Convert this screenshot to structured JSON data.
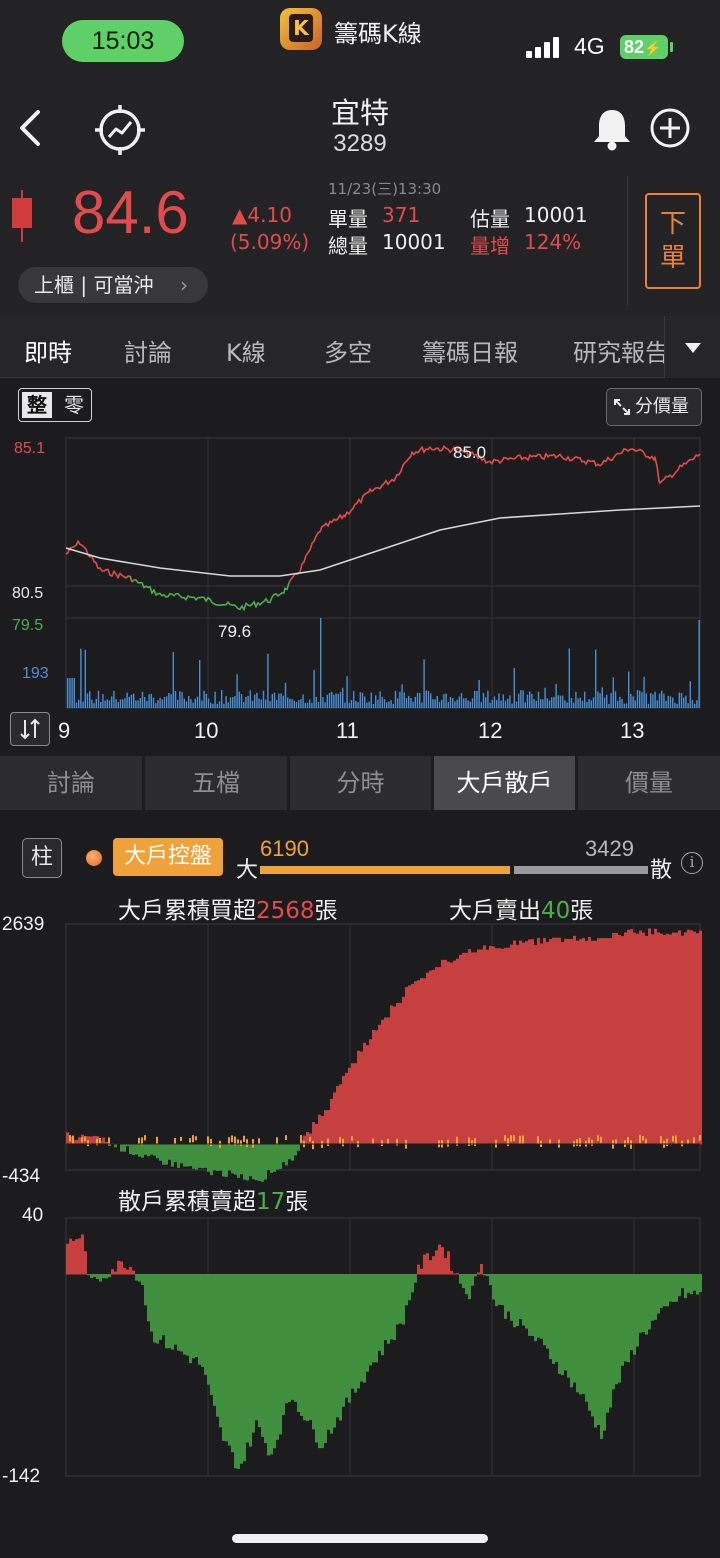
{
  "status_bar": {
    "time": "15:03",
    "app_name": "籌碼K線",
    "network": "4G",
    "battery": "82"
  },
  "header": {
    "stock_name": "宜特",
    "stock_code": "3289",
    "price": "84.6",
    "change": "▲4.10",
    "change_pct": "(5.09%)",
    "datetime": "11/23(三)13:30",
    "unit_volume_label": "單量",
    "unit_volume": "371",
    "total_volume_label": "總量",
    "total_volume": "10001",
    "est_volume_label": "估量",
    "est_volume": "10001",
    "volume_increase_label": "量增",
    "volume_increase": "124%",
    "market_tag": "上櫃 | 可當沖",
    "order_button": "下單",
    "colors": {
      "up": "#e24b4b",
      "accent": "#e8823a"
    }
  },
  "tabs": [
    "即時",
    "討論",
    "K線",
    "多空",
    "籌碼日報",
    "研究報告"
  ],
  "intraday": {
    "toggle_on": "整",
    "toggle_off": "零",
    "price_volume_button": "分價量",
    "y_high": "85.1",
    "y_mid": "80.5",
    "y_low": "79.5",
    "vol_max": "193",
    "annot_high": "85.0",
    "annot_low": "79.6",
    "x_labels": [
      "9",
      "10",
      "11",
      "12",
      "13"
    ]
  },
  "sub_tabs": [
    "討論",
    "五檔",
    "分時",
    "大戶散戶",
    "價量"
  ],
  "sub_tab_active": 3,
  "big_small": {
    "col_button": "柱",
    "control_label": "大戶控盤",
    "big_label": "大",
    "big_value": "6190",
    "small_value": "3429",
    "small_label": "散",
    "big_caption_prefix": "大戶累積買超",
    "big_caption_value": "2568",
    "big_caption_unit": "張",
    "big_sell_prefix": "大戶賣出",
    "big_sell_value": "40",
    "big_sell_unit": "張",
    "big_y_max": "2639",
    "big_y_min": "-434",
    "small_caption_prefix": "散戶累積賣超",
    "small_caption_value": "17",
    "small_caption_unit": "張",
    "small_y_max": "40",
    "small_y_min": "-142"
  }
}
